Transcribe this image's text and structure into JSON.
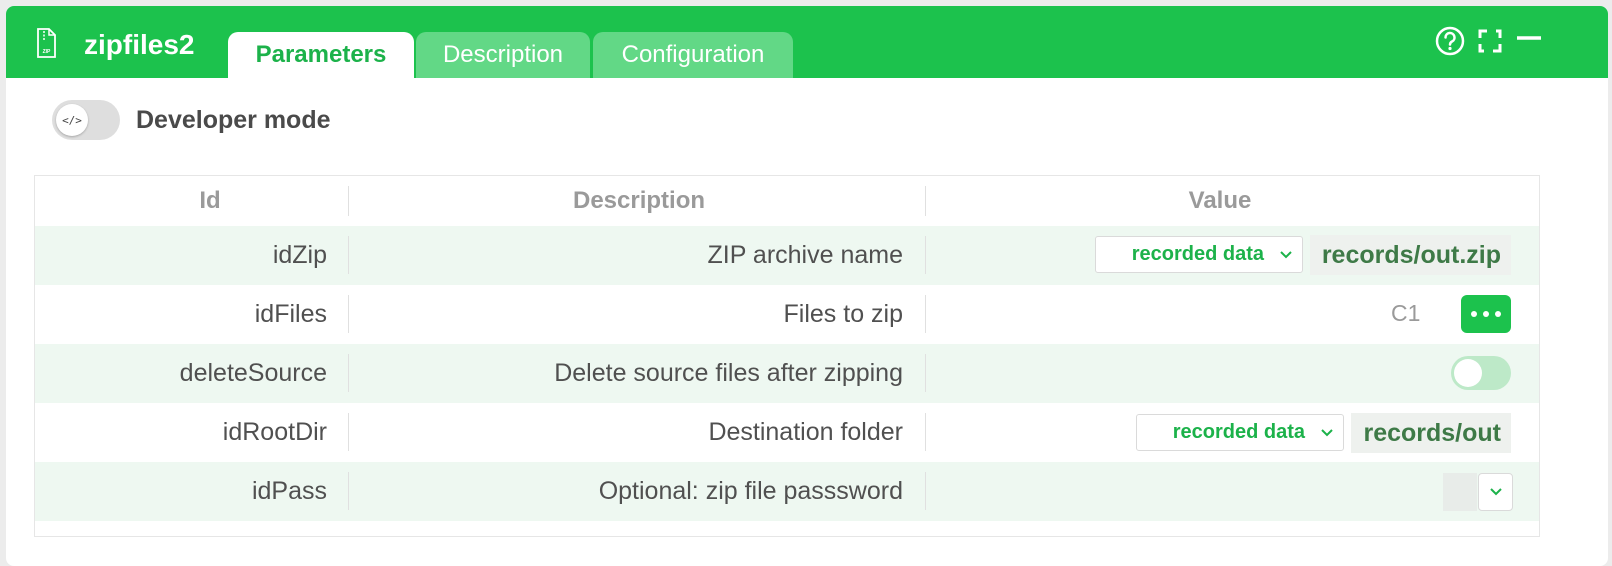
{
  "node": {
    "title": "zipfiles2",
    "icon": "zip-file-icon"
  },
  "tabs": [
    {
      "label": "Parameters",
      "active": true
    },
    {
      "label": "Description",
      "active": false
    },
    {
      "label": "Configuration",
      "active": false
    }
  ],
  "title_buttons": [
    "help-icon",
    "expand-icon",
    "minimize-icon"
  ],
  "developer_mode": {
    "label": "Developer mode",
    "knob_text": "</>",
    "enabled": false
  },
  "table": {
    "headers": {
      "id": "Id",
      "description": "Description",
      "value": "Value"
    },
    "rows": [
      {
        "id": "idZip",
        "description": "ZIP archive name",
        "source": "recorded data",
        "value": "records/out.zip"
      },
      {
        "id": "idFiles",
        "description": "Files to zip",
        "value": "C1"
      },
      {
        "id": "deleteSource",
        "description": "Delete source files after zipping",
        "toggle": false
      },
      {
        "id": "idRootDir",
        "description": "Destination folder",
        "source": "recorded data",
        "value": "records/out"
      },
      {
        "id": "idPass",
        "description": "Optional: zip file passsword",
        "value": ""
      }
    ]
  },
  "colors": {
    "accent": "#1cc24d",
    "accent_text": "#1cb24a",
    "row_alt": "#eef8f1"
  }
}
